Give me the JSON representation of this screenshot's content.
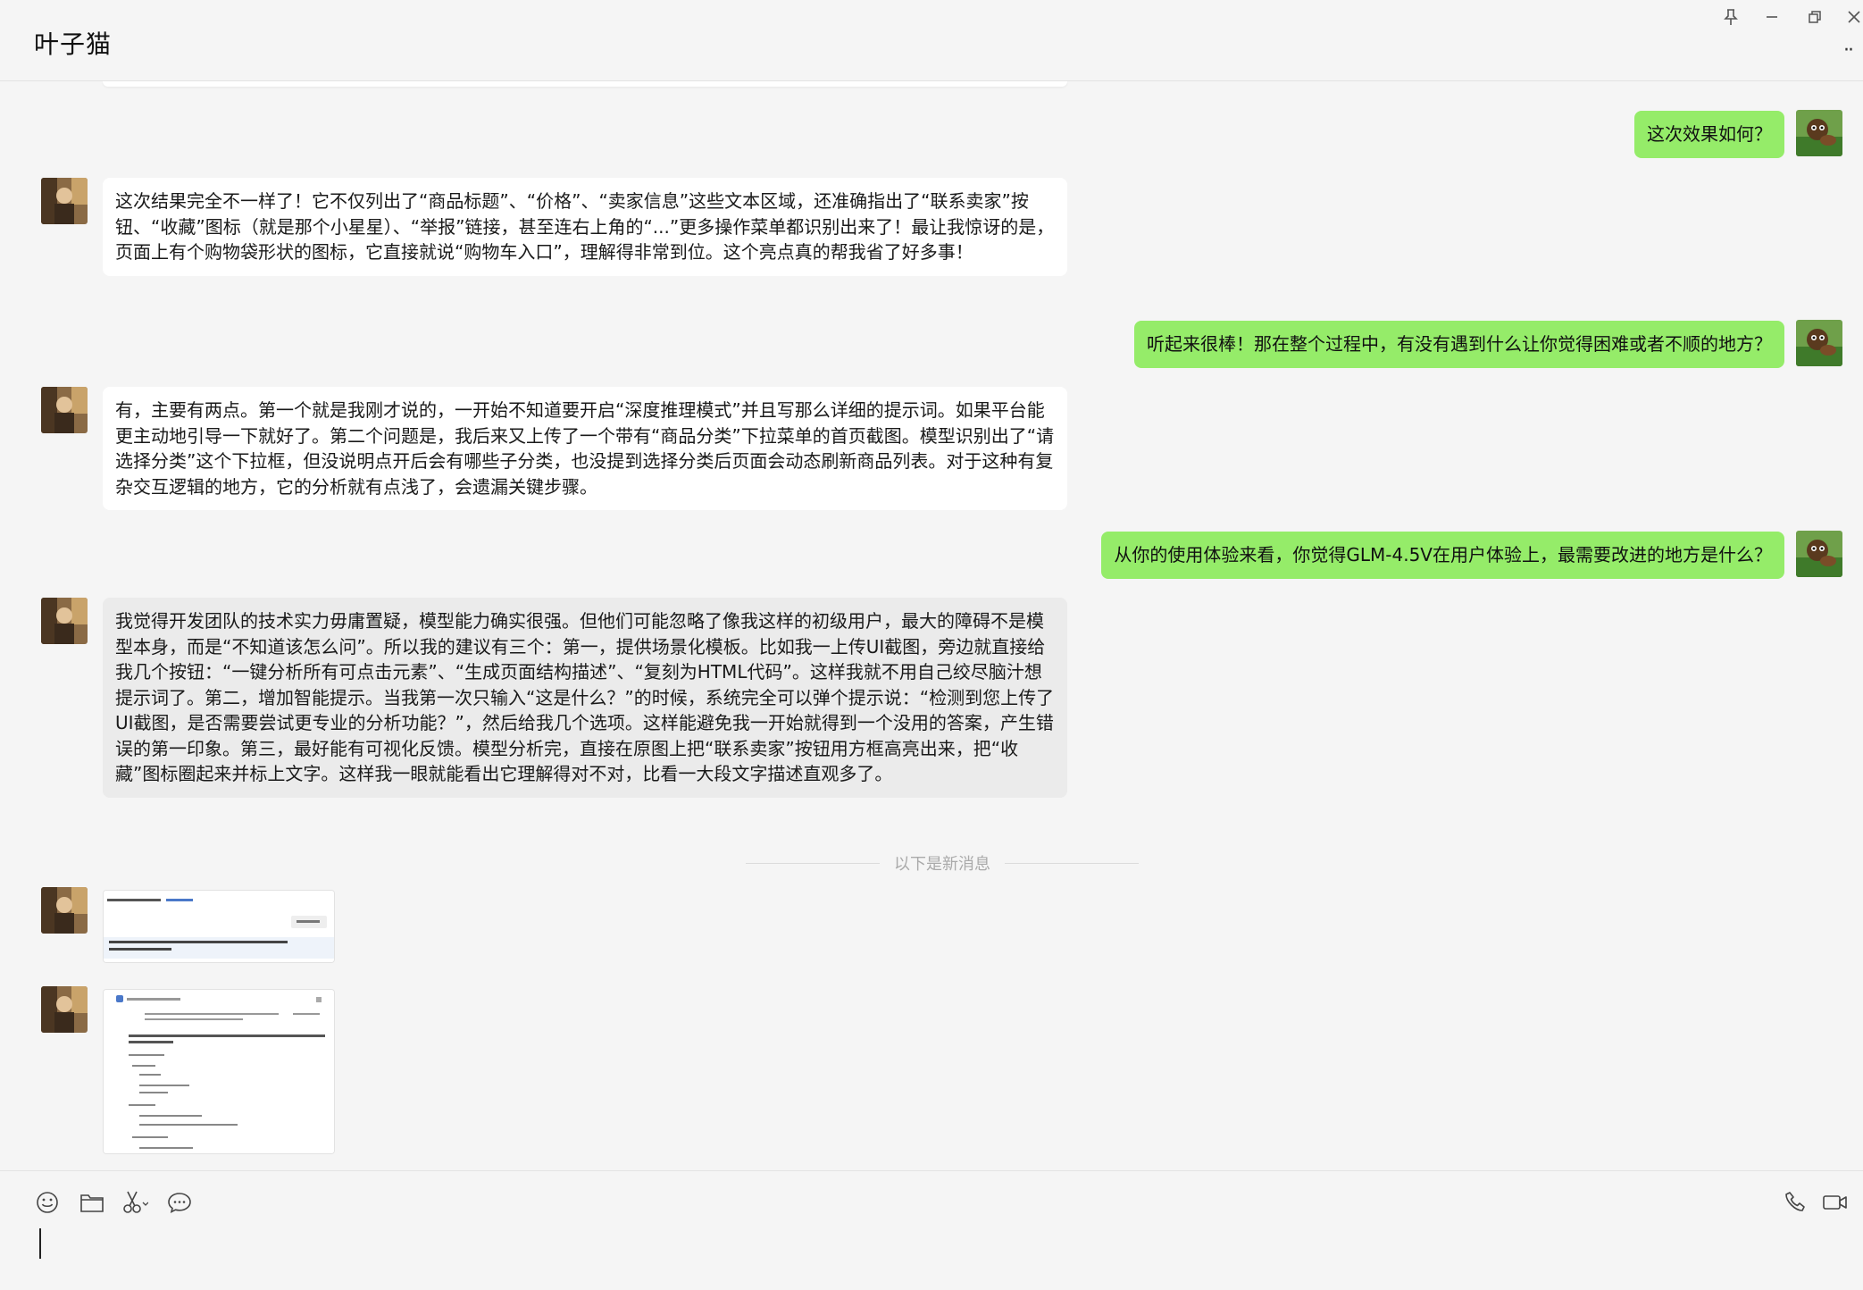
{
  "header": {
    "title": "叶子猫"
  },
  "window_controls": [
    {
      "name": "pin-icon",
      "glyph": "⊥"
    },
    {
      "name": "minimize-icon",
      "glyph": "—"
    },
    {
      "name": "restore-icon",
      "glyph": "❐"
    },
    {
      "name": "close-icon",
      "glyph": "✕"
    }
  ],
  "more_label": "··",
  "messages": [
    {
      "side": "right",
      "text": "这次效果如何？"
    },
    {
      "side": "left",
      "text": "这次结果完全不一样了！它不仅列出了“商品标题”、“价格”、“卖家信息”这些文本区域，还准确指出了“联系卖家”按钮、“收藏”图标（就是那个小星星）、“举报”链接，甚至连右上角的“...”更多操作菜单都识别出来了！最让我惊讶的是，页面上有个购物袋形状的图标，它直接就说“购物车入口”，理解得非常到位。这个亮点真的帮我省了好多事！"
    },
    {
      "side": "right",
      "text": "听起来很棒！那在整个过程中，有没有遇到什么让你觉得困难或者不顺的地方？"
    },
    {
      "side": "left",
      "text": "有，主要有两点。第一个就是我刚才说的，一开始不知道要开启“深度推理模式”并且写那么详细的提示词。如果平台能更主动地引导一下就好了。第二个问题是，我后来又上传了一个带有“商品分类”下拉菜单的首页截图。模型识别出了“请选择分类”这个下拉框，但没说明点开后会有哪些子分类，也没提到选择分类后页面会动态刷新商品列表。对于这种有复杂交互逻辑的地方，它的分析就有点浅了，会遗漏关键步骤。"
    },
    {
      "side": "right",
      "text": "从你的使用体验来看，你觉得GLM-4.5V在用户体验上，最需要改进的地方是什么？"
    },
    {
      "side": "left",
      "text": "我觉得开发团队的技术实力毋庸置疑，模型能力确实很强。但他们可能忽略了像我这样的初级用户，最大的障碍不是模型本身，而是“不知道该怎么问”。所以我的建议有三个：第一，提供场景化模板。比如我一上传UI截图，旁边就直接给我几个按钮：“一键分析所有可点击元素”、“生成页面结构描述”、“复刻为HTML代码”。这样我就不用自己绞尽脑汁想提示词了。第二，增加智能提示。当我第一次只输入“这是什么？”的时候，系统完全可以弹个提示说：“检测到您上传了UI截图，是否需要尝试更专业的分析功能？”，然后给我几个选项。这样能避免我一开始就得到一个没用的答案，产生错误的第一印象。第三，最好能有可视化反馈。模型分析完，直接在原图上把“联系卖家”按钮用方框高亮出来，把“收藏”图标圈起来并标上文字。这样我一眼就能看出它理解得对不对，比看一大段文字描述直观多了。"
    }
  ],
  "new_messages_divider": "以下是新消息",
  "colors": {
    "outgoing_bubble": "#95ec69",
    "incoming_bubble": "#ffffff",
    "background": "#f5f5f5"
  },
  "toolbar": {
    "left_tools": [
      "emoji-icon",
      "folder-icon",
      "scissors-icon",
      "chat-bubble-icon"
    ],
    "right_tools": [
      "phone-icon",
      "video-icon"
    ]
  }
}
